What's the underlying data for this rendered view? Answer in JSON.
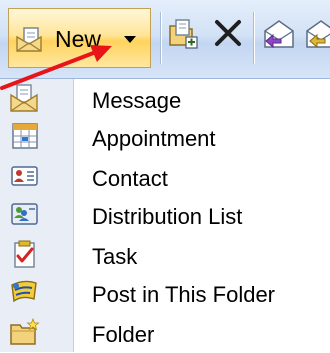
{
  "toolbar": {
    "new_label": "New",
    "new_icon": "new-item-icon",
    "buttons": [
      {
        "name": "move-to-folder-icon"
      },
      {
        "name": "delete-icon"
      },
      {
        "name": "reply-icon"
      },
      {
        "name": "reply-all-icon"
      }
    ]
  },
  "menu": {
    "items": [
      {
        "label": "Message",
        "icon": "message-icon"
      },
      {
        "label": "Appointment",
        "icon": "appointment-icon"
      },
      {
        "label": "Contact",
        "icon": "contact-icon"
      },
      {
        "label": "Distribution List",
        "icon": "distribution-list-icon"
      },
      {
        "label": "Task",
        "icon": "task-icon"
      },
      {
        "label": "Post in This Folder",
        "icon": "post-icon"
      },
      {
        "label": "Folder",
        "icon": "folder-icon"
      }
    ]
  },
  "colors": {
    "toolbar_bg": "#d3e2f6",
    "hover_button": "#ffd35c",
    "menu_gutter": "#e9eef6",
    "annotation_arrow": "#e8141a"
  }
}
